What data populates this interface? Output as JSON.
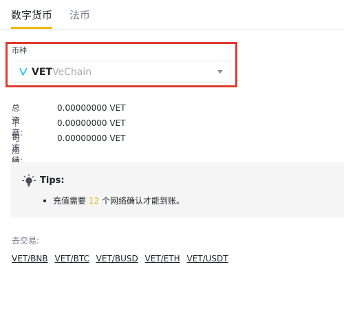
{
  "tabs": [
    {
      "label": "数字货币",
      "active": true
    },
    {
      "label": "法币",
      "active": false
    }
  ],
  "coin_select": {
    "label": "币种",
    "symbol": "VET",
    "name": "VeChain"
  },
  "balances": [
    {
      "label": "总资产:",
      "value": "0.00000000 VET"
    },
    {
      "label": "下单冻结:",
      "value": "0.00000000 VET"
    },
    {
      "label": "可用资产:",
      "value": "0.00000000 VET"
    }
  ],
  "tips": {
    "title": "Tips:",
    "line_prefix": "充值需要",
    "confirmations": "12",
    "line_suffix": "个网络确认才能到账。"
  },
  "trade": {
    "label": "去交易:",
    "pairs": [
      "VET/BNB",
      "VET/BTC",
      "VET/BUSD",
      "VET/ETH",
      "VET/USDT"
    ]
  },
  "colors": {
    "accent": "#f0b90b",
    "highlight_border": "#e03a2f",
    "vet_logo": "#15bdff"
  }
}
